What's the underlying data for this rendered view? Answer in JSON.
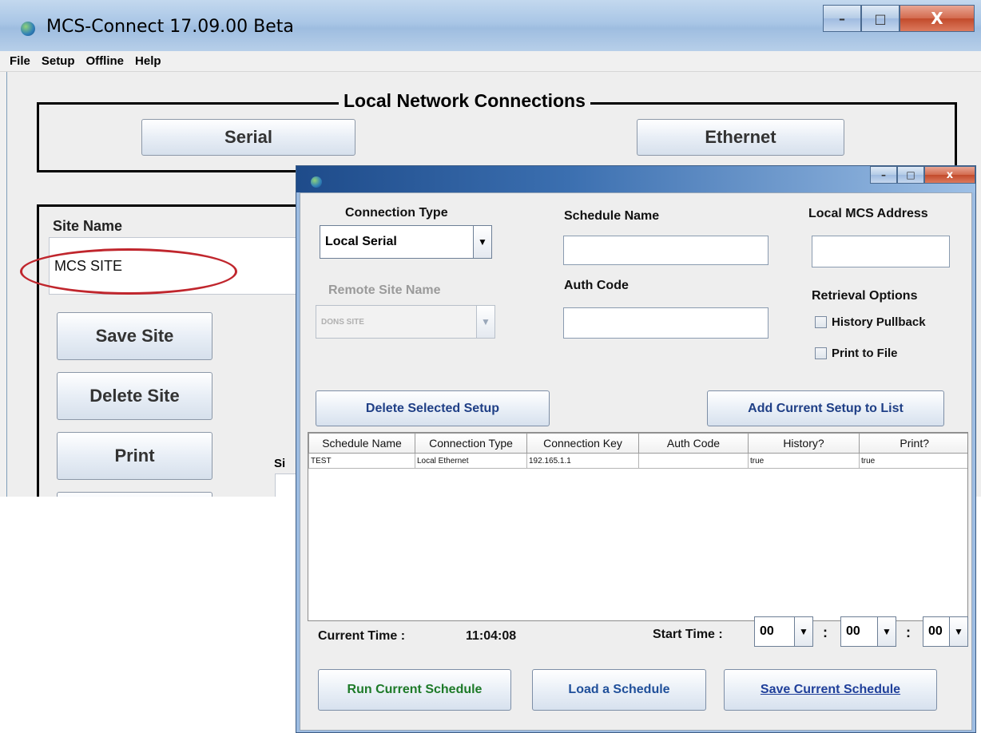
{
  "main_window": {
    "title": "MCS-Connect 17.09.00 Beta",
    "minimize": "–",
    "maximize": "□",
    "close": "X",
    "menu": [
      "File",
      "Setup",
      "Offline",
      "Help"
    ],
    "network_group_title": "Local Network Connections",
    "serial_button": "Serial",
    "ethernet_button": "Ethernet",
    "site_name_label": "Site Name",
    "site_name_value": "MCS SITE",
    "save_site_button": "Save Site",
    "delete_site_button": "Delete Site",
    "print_button": "Print",
    "partial_label": "Si"
  },
  "dialog": {
    "minimize": "–",
    "maximize": "□",
    "close": "x",
    "connection_type_label": "Connection Type",
    "connection_type_value": "Local Serial",
    "schedule_name_label": "Schedule Name",
    "schedule_name_value": "",
    "local_mcs_address_label": "Local MCS Address",
    "local_mcs_address_value": "",
    "remote_site_name_label": "Remote Site Name",
    "remote_site_name_value": "DONS SITE",
    "auth_code_label": "Auth Code",
    "auth_code_value": "",
    "retrieval_options_label": "Retrieval Options",
    "history_pullback_label": "History Pullback",
    "print_to_file_label": "Print to File",
    "delete_selected_button": "Delete Selected Setup",
    "add_current_button": "Add Current Setup to List",
    "table": {
      "columns": [
        "Schedule Name",
        "Connection Type",
        "Connection Key",
        "Auth Code",
        "History?",
        "Print?"
      ],
      "rows": [
        [
          "TEST",
          "Local Ethernet",
          "192.165.1.1",
          "",
          "true",
          "true"
        ]
      ]
    },
    "current_time_label": "Current Time :",
    "current_time_value": "11:04:08",
    "start_time_label": "Start Time :",
    "start_hour": "00",
    "start_minute": "00",
    "start_second": "00",
    "time_separator": ":",
    "run_button": "Run Current Schedule",
    "load_button": "Load a Schedule",
    "save_button": "Save Current Schedule",
    "colors": {
      "run": "#1d7a28",
      "load": "#1f4f9a",
      "save": "#1f3f9a",
      "ellipse": "#c0262d"
    }
  }
}
